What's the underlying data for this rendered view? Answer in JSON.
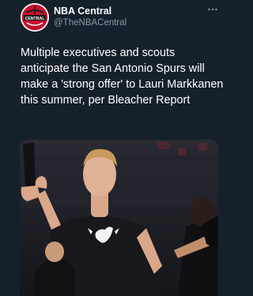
{
  "tweet": {
    "author_name": "NBA Central",
    "author_handle": "@TheNBACentral",
    "text": "Multiple executives and scouts anticipate the San Antonio Spurs will make a 'strong offer' to Lauri Markkanen this summer, per Bleacher Report",
    "more_icon": "ellipsis-icon",
    "avatar_logo_text": "CENTRAL"
  },
  "colors": {
    "background": "#15202b",
    "secondary_text": "#8b98a5",
    "avatar_red": "#c8102e"
  }
}
